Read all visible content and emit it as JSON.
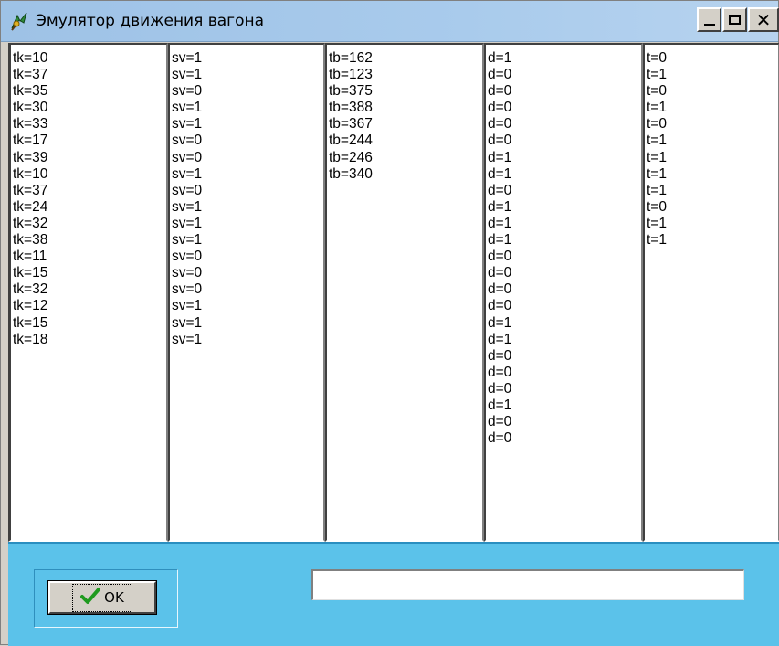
{
  "window": {
    "title": "Эмулятор движения вагона",
    "icon": "app-leaf-icon",
    "caption_buttons": [
      "minimize-icon",
      "maximize-icon",
      "close-icon"
    ],
    "close_glyph": "✕"
  },
  "lists": [
    {
      "items": [
        "tk=10",
        "tk=37",
        "tk=35",
        "tk=30",
        "tk=33",
        "tk=17",
        "tk=39",
        "tk=10",
        "tk=37",
        "tk=24",
        "tk=32",
        "tk=38",
        "tk=11",
        "tk=15",
        "tk=32",
        "tk=12",
        "tk=15",
        "tk=18"
      ]
    },
    {
      "items": [
        "sv=1",
        "sv=1",
        "sv=0",
        "sv=1",
        "sv=1",
        "sv=0",
        "sv=0",
        "sv=1",
        "sv=0",
        "sv=1",
        "sv=1",
        "sv=1",
        "sv=0",
        "sv=0",
        "sv=0",
        "sv=1",
        "sv=1",
        "sv=1"
      ]
    },
    {
      "items": [
        "tb=162",
        "tb=123",
        "tb=375",
        "tb=388",
        "tb=367",
        "tb=244",
        "tb=246",
        "tb=340"
      ]
    },
    {
      "items": [
        "d=1",
        "d=0",
        "d=0",
        "d=0",
        "d=0",
        "d=0",
        "d=1",
        "d=1",
        "d=0",
        "d=1",
        "d=1",
        "d=1",
        "d=0",
        "d=0",
        "d=0",
        "d=0",
        "d=1",
        "d=1",
        "d=0",
        "d=0",
        "d=0",
        "d=1",
        "d=0",
        "d=0"
      ]
    },
    {
      "items": [
        "t=0",
        "t=1",
        "t=0",
        "t=1",
        "t=0",
        "t=1",
        "t=1",
        "t=1",
        "t=1",
        "t=0",
        "t=1",
        "t=1"
      ]
    }
  ],
  "bottom": {
    "ok_label": "OK",
    "ok_icon": "checkmark-icon",
    "input_value": "",
    "panel_color": "#5bc2ea"
  }
}
